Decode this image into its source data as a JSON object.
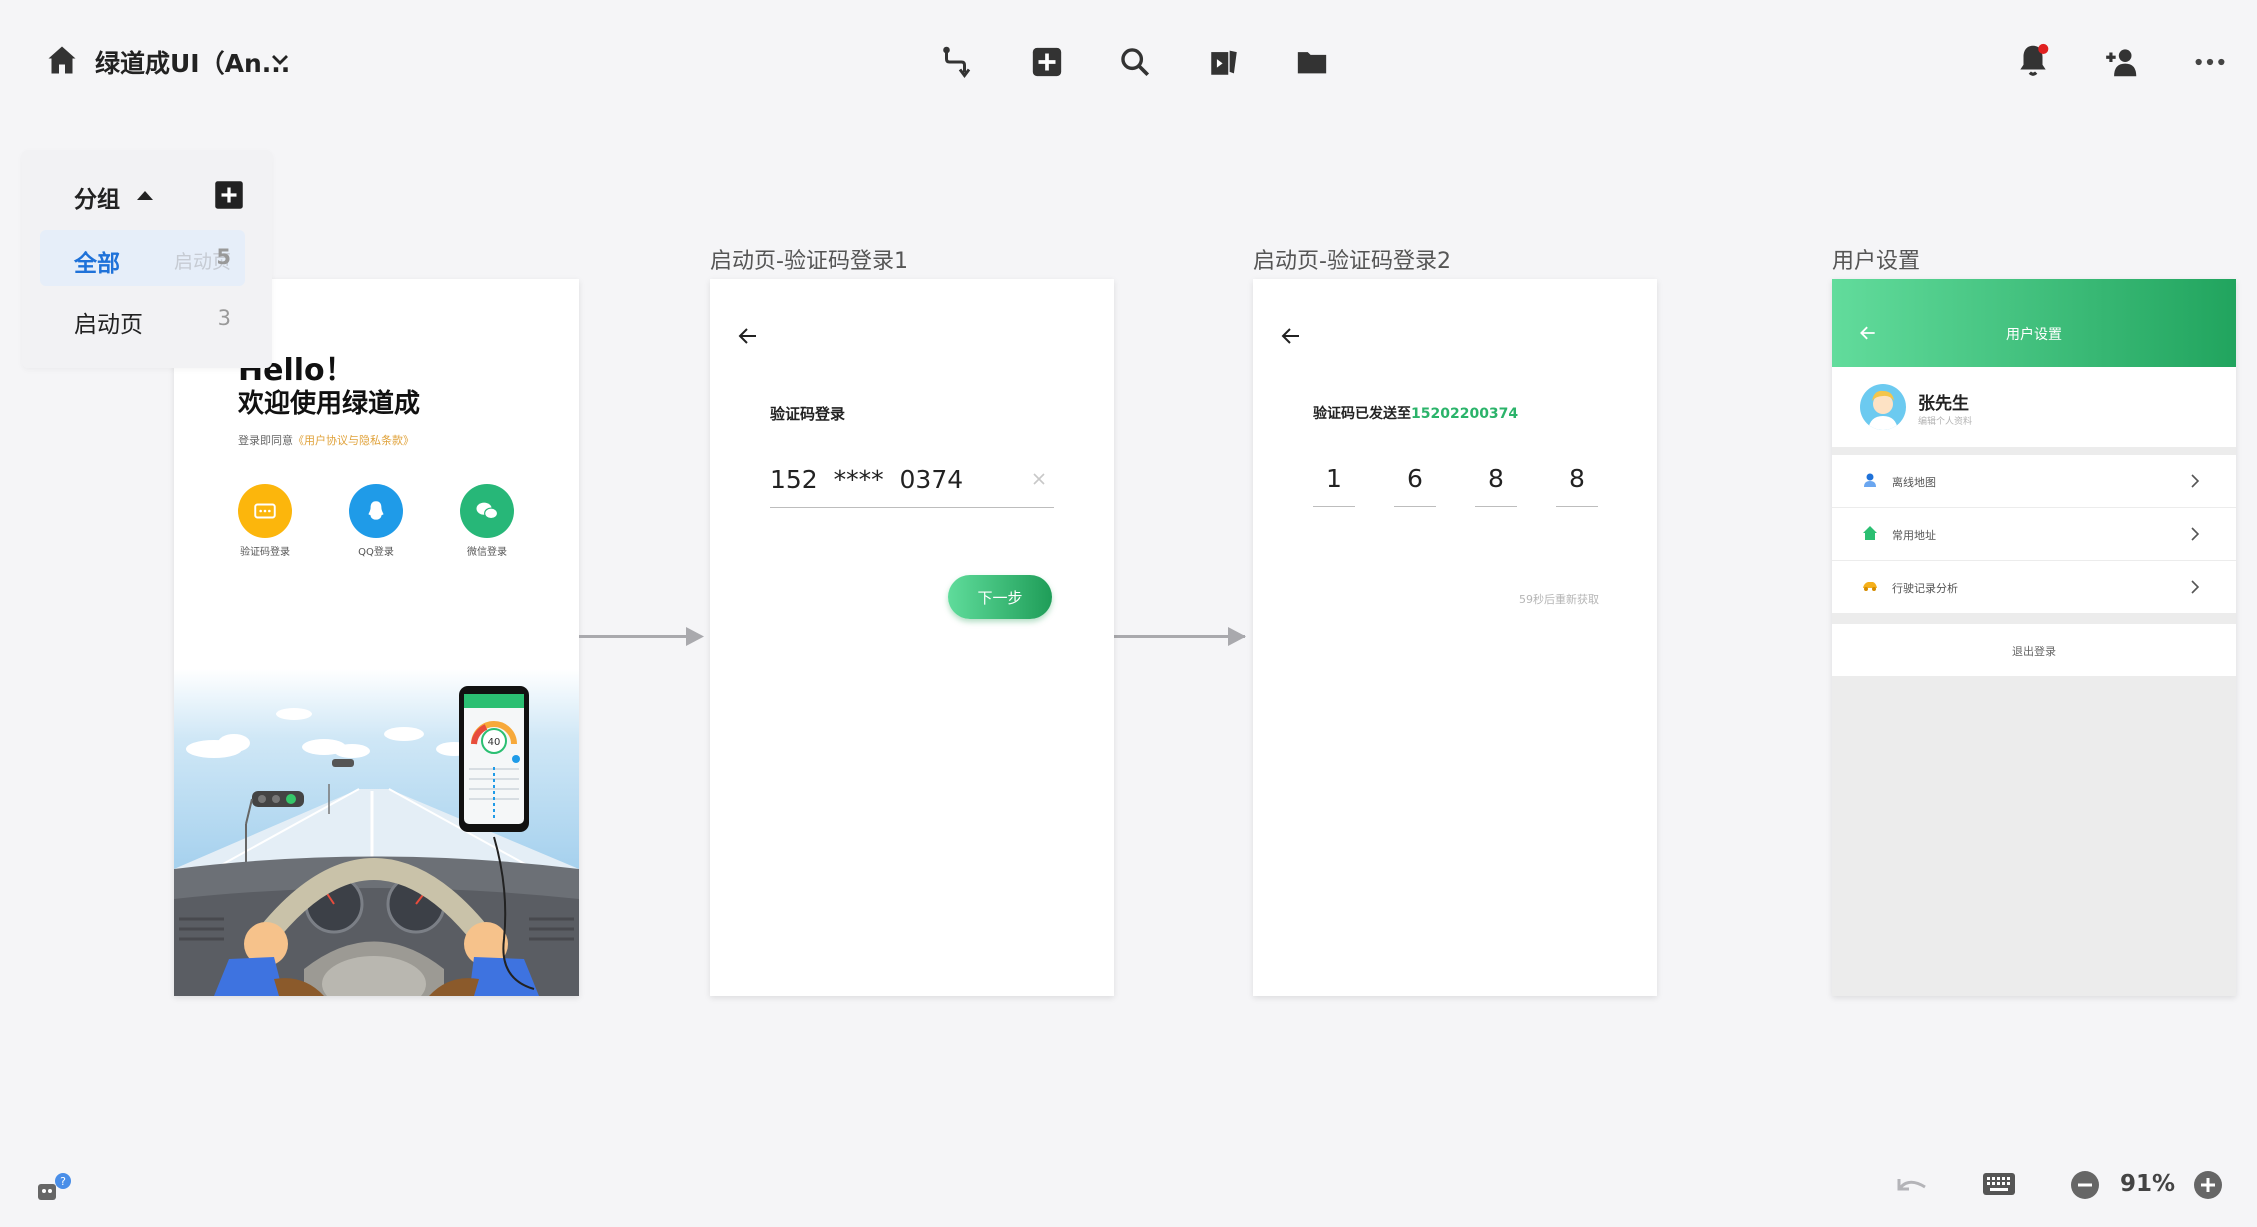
{
  "topbar": {
    "home_icon": "home-icon",
    "project_title": "绿道成UI（An...",
    "tools": [
      "flow-icon",
      "add-square-icon",
      "search-icon",
      "cards-icon",
      "folder-icon"
    ],
    "right": [
      "bell-icon",
      "add-user-icon",
      "more-icon"
    ],
    "notification_color": "#e02020"
  },
  "groups": {
    "header": "分组",
    "items": [
      {
        "label": "全部",
        "count": "5",
        "ghost": "启动页"
      },
      {
        "label": "启动页",
        "count": "3"
      }
    ]
  },
  "pages": [
    {
      "title": "",
      "hello": "Hello！",
      "welcome": "欢迎使用绿道成",
      "agree_prefix": "登录即同意",
      "agree_link": "《用户协议与隐私条款》",
      "login_options": [
        {
          "label": "验证码登录",
          "color": "#fcb60c"
        },
        {
          "label": "QQ登录",
          "color": "#1f9be8"
        },
        {
          "label": "微信登录",
          "color": "#27b778"
        }
      ],
      "phone_speed": "40"
    },
    {
      "title": "启动页-验证码登录1",
      "heading": "验证码登录",
      "phone": "152  ****  0374",
      "next_button": "下一步"
    },
    {
      "title": "启动页-验证码登录2",
      "sent_prefix": "验证码已发送至",
      "sent_number": "15202200374",
      "digits": [
        "1",
        "6",
        "8",
        "8"
      ],
      "resend": "59秒后重新获取"
    },
    {
      "title": "用户设置",
      "header_title": "用户设置",
      "user_name": "张先生",
      "user_sub": "编辑个人资料",
      "menu": [
        {
          "label": "离线地图",
          "icon": "user-pin-icon",
          "color": "#1f72d9"
        },
        {
          "label": "常用地址",
          "icon": "home-icon",
          "color": "#2bbf72"
        },
        {
          "label": "行驶记录分析",
          "icon": "car-icon",
          "color": "#f5b01b"
        }
      ],
      "logout": "退出登录"
    }
  ],
  "bottom": {
    "zoom": "91%"
  }
}
